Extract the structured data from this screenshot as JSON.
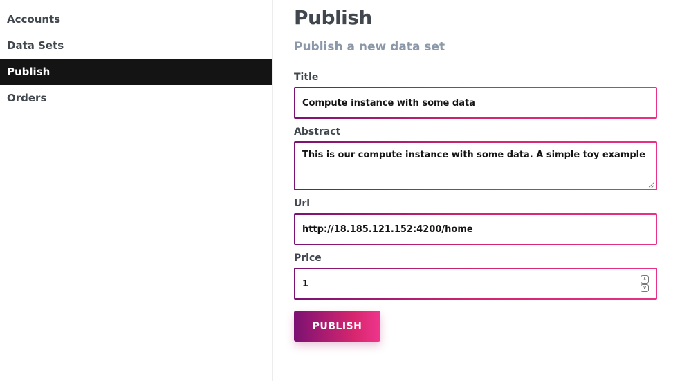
{
  "sidebar": {
    "items": [
      {
        "label": "Accounts",
        "active": false
      },
      {
        "label": "Data Sets",
        "active": false
      },
      {
        "label": "Publish",
        "active": true
      },
      {
        "label": "Orders",
        "active": false
      }
    ]
  },
  "main": {
    "title": "Publish",
    "subtitle": "Publish a new data set",
    "form": {
      "title_label": "Title",
      "title_value": "Compute instance with some data",
      "abstract_label": "Abstract",
      "abstract_value": "This is our compute instance with some data. A simple toy example",
      "url_label": "Url",
      "url_value": "http://18.185.121.152:4200/home",
      "price_label": "Price",
      "price_value": "1",
      "submit_label": "PUBLISH"
    }
  },
  "colors": {
    "sidebar_active_bg": "#141414",
    "accent_start": "#7b1173",
    "accent_end": "#f0358d",
    "subtitle": "#8b98a9",
    "text": "#41474e"
  },
  "icons": {
    "spinner_up": "chevron-up-icon",
    "spinner_down": "chevron-down-icon",
    "resize": "resize-grip-icon"
  }
}
